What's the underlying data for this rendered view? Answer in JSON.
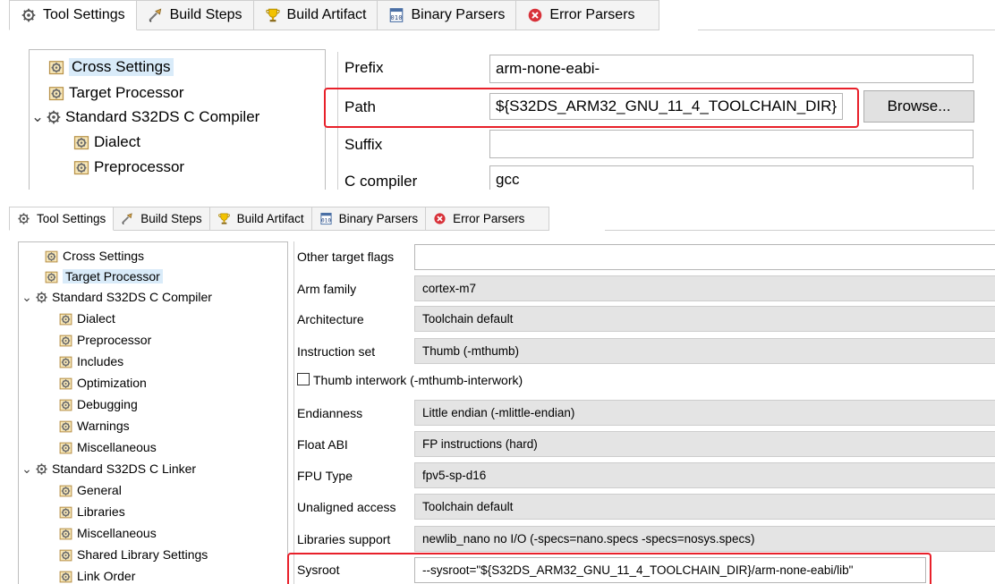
{
  "tabs": [
    {
      "label": "Tool Settings",
      "icon": "tool-settings-icon"
    },
    {
      "label": "Build Steps",
      "icon": "build-steps-icon"
    },
    {
      "label": "Build Artifact",
      "icon": "build-artifact-icon"
    },
    {
      "label": "Binary Parsers",
      "icon": "binary-parsers-icon"
    },
    {
      "label": "Error Parsers",
      "icon": "error-parsers-icon"
    }
  ],
  "top_panel": {
    "tree": [
      "Cross Settings",
      "Target Processor",
      "Standard S32DS C Compiler",
      "Dialect",
      "Preprocessor"
    ],
    "fields": {
      "prefix_label": "Prefix",
      "prefix_value": "arm-none-eabi-",
      "path_label": "Path",
      "path_value": "${S32DS_ARM32_GNU_11_4_TOOLCHAIN_DIR}",
      "browse_label": "Browse...",
      "suffix_label": "Suffix",
      "suffix_value": "",
      "ccompiler_label": "C compiler",
      "ccompiler_value": "gcc"
    }
  },
  "bottom_panel": {
    "tree": [
      "Cross Settings",
      "Target Processor",
      "Standard S32DS C Compiler",
      "Dialect",
      "Preprocessor",
      "Includes",
      "Optimization",
      "Debugging",
      "Warnings",
      "Miscellaneous",
      "Standard S32DS C Linker",
      "General",
      "Libraries",
      "Miscellaneous",
      "Shared Library Settings",
      "Link Order"
    ],
    "fields": {
      "other_flags_label": "Other target flags",
      "other_flags_value": "",
      "arm_family_label": "Arm family",
      "arm_family_value": "cortex-m7",
      "architecture_label": "Architecture",
      "architecture_value": "Toolchain default",
      "instruction_set_label": "Instruction set",
      "instruction_set_value": "Thumb (-mthumb)",
      "thumb_interwork_label": "Thumb interwork (-mthumb-interwork)",
      "thumb_interwork_checked": false,
      "endianness_label": "Endianness",
      "endianness_value": "Little endian (-mlittle-endian)",
      "float_abi_label": "Float ABI",
      "float_abi_value": "FP instructions (hard)",
      "fpu_type_label": "FPU Type",
      "fpu_type_value": "fpv5-sp-d16",
      "unaligned_label": "Unaligned access",
      "unaligned_value": "Toolchain default",
      "libraries_support_label": "Libraries support",
      "libraries_support_value": "newlib_nano no I/O (-specs=nano.specs -specs=nosys.specs)",
      "sysroot_label": "Sysroot",
      "sysroot_value": "--sysroot=\"${S32DS_ARM32_GNU_11_4_TOOLCHAIN_DIR}/arm-none-eabi/lib\""
    }
  },
  "colors": {
    "highlight_border": "#e8202a",
    "selection": "#d9ebf9",
    "readonly_field": "#e4e4e4"
  }
}
